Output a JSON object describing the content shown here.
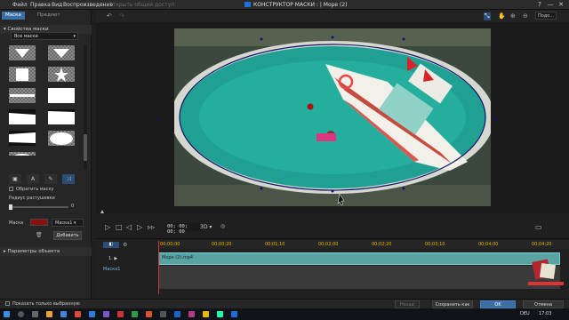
{
  "menu": {
    "items": [
      "Файл",
      "Правка",
      "Вид",
      "Воспроизведение"
    ],
    "disabled_item": "Открыть общий доступ"
  },
  "window": {
    "title": "КОНСТРУКТОР МАСКИ : | Море (2)",
    "help": "?",
    "minimize": "—",
    "maximize": "□",
    "close": "✕"
  },
  "left_panel": {
    "tabs": [
      "Маска",
      "Предмет"
    ],
    "section_title": "Свойства маски",
    "category_select": "Все маски",
    "invert_mask_label": "Обратить маску",
    "feather_radius_label": "Радиус растушевки",
    "feather_value": "0",
    "mask_label": "Маска",
    "mask_color": "#8b1010",
    "mask_select": "Маска1",
    "add_button": "Добавить",
    "object_params": "Параметры объекта"
  },
  "preview_toolbar": {
    "zoom": "Подо..."
  },
  "playback": {
    "timecode": "00; 00; 00; 00",
    "mode_3d": "3D"
  },
  "timeline": {
    "ticks": [
      "00;00;00",
      "00;00;20",
      "00;01;10",
      "00;02;00",
      "00;02;20",
      "00;03;10",
      "00;04;00",
      "00;04;20"
    ],
    "video_track_label": "1.",
    "mask_track_label": "Маска1",
    "clip_name": "Море (2).mp4"
  },
  "bottom_bar": {
    "show_selected_label": "Показать только выбранную",
    "prev_button": "Назад",
    "save_as_button": "Сохранить как",
    "ok_button": "OK",
    "cancel_button": "Отмена"
  },
  "taskbar": {
    "language": "DEU",
    "time": "17:03"
  }
}
